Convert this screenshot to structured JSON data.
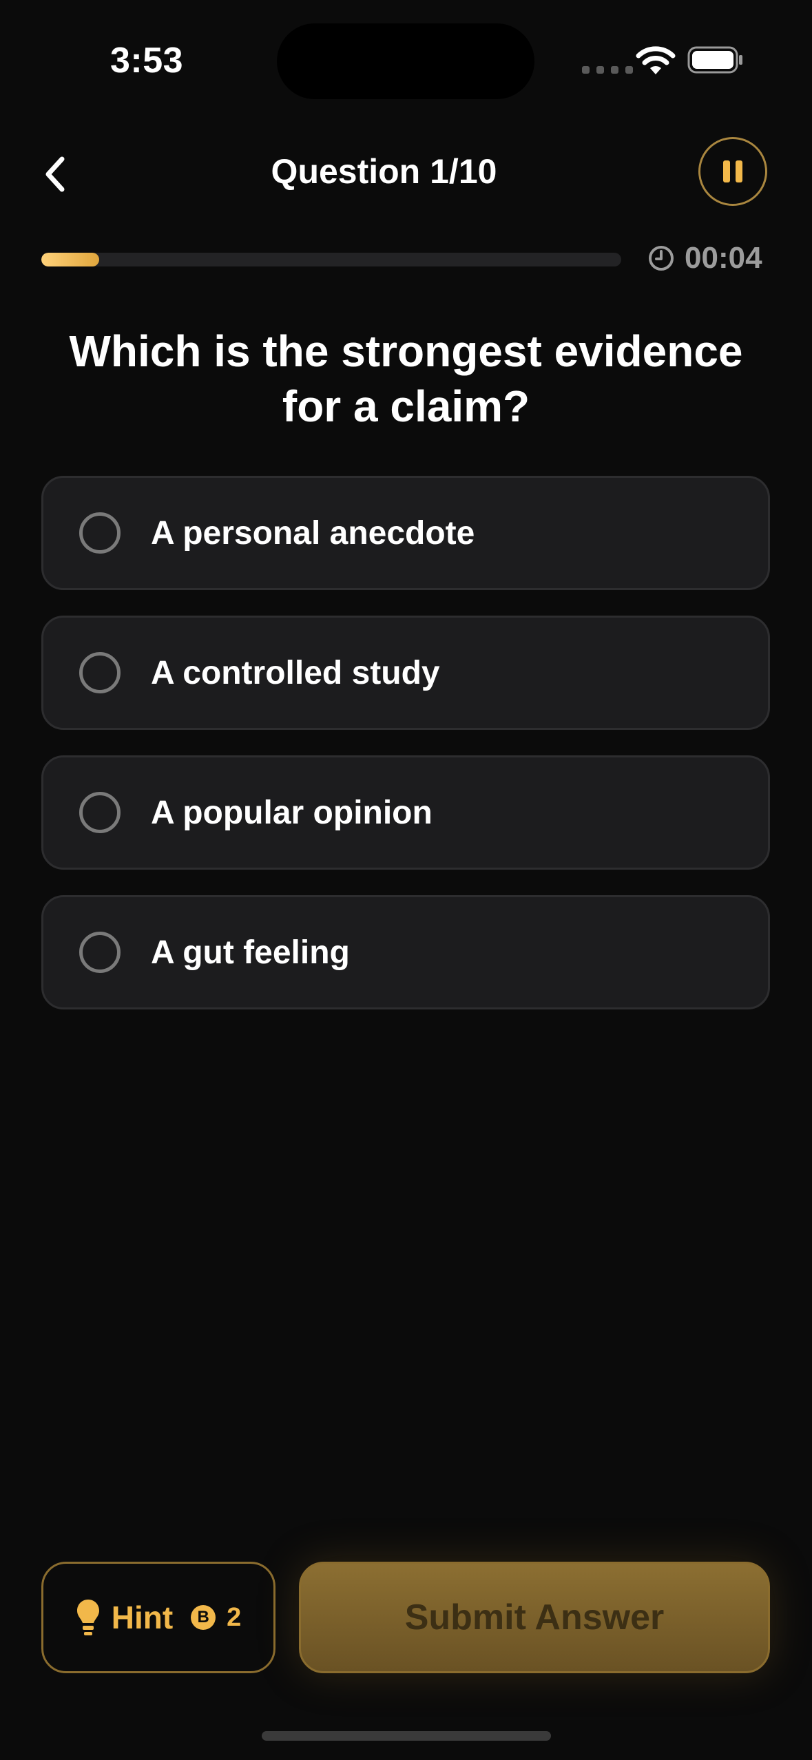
{
  "status_bar": {
    "time": "3:53"
  },
  "header": {
    "title": "Question 1/10",
    "back_icon": "chevron-left-icon",
    "pause_icon": "pause-icon"
  },
  "progress": {
    "fraction": 0.1,
    "timer": "00:04",
    "timer_icon": "clock-icon"
  },
  "question": {
    "text": "Which is the strongest evidence for a claim?"
  },
  "options": [
    {
      "label": "A personal anecdote"
    },
    {
      "label": "A controlled study"
    },
    {
      "label": "A popular opinion"
    },
    {
      "label": "A gut feeling"
    }
  ],
  "footer": {
    "hint_label": "Hint",
    "hint_coin_symbol": "B",
    "hint_cost": "2",
    "submit_label": "Submit Answer"
  },
  "colors": {
    "accent": "#f2b84a",
    "background": "#0b0b0b",
    "card": "#1c1c1e"
  }
}
